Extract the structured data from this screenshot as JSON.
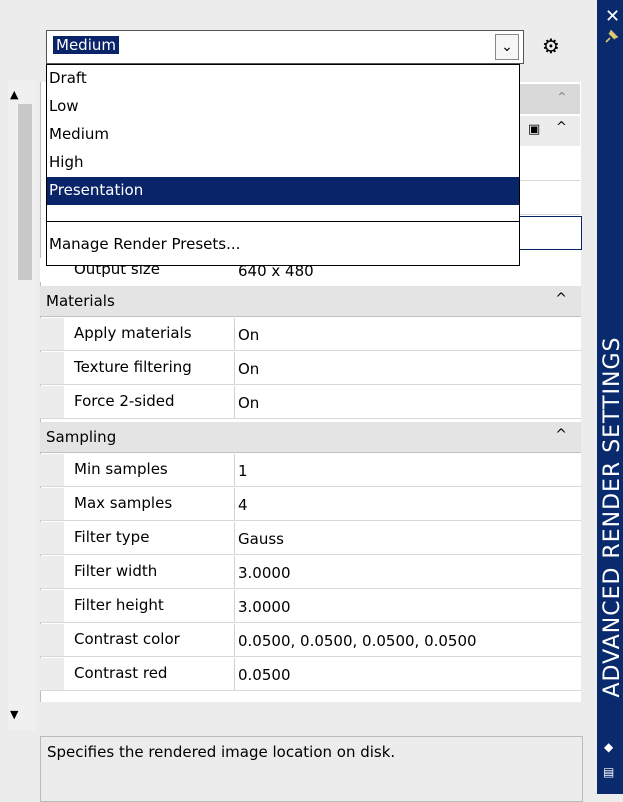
{
  "palette": {
    "title": "ADVANCED RENDER SETTINGS",
    "preset_combo": {
      "selected": "Medium",
      "options": [
        "Draft",
        "Low",
        "Medium",
        "High",
        "Presentation"
      ],
      "highlighted": "Presentation",
      "manage_label": "Manage Render Presets..."
    },
    "output_size": {
      "label": "Output size",
      "value": "640 x 480"
    },
    "sections": [
      {
        "name": "Materials",
        "rows": [
          {
            "label": "Apply materials",
            "value": "On"
          },
          {
            "label": "Texture filtering",
            "value": "On"
          },
          {
            "label": "Force 2-sided",
            "value": "On"
          }
        ]
      },
      {
        "name": "Sampling",
        "rows": [
          {
            "label": "Min samples",
            "value": "1"
          },
          {
            "label": "Max samples",
            "value": "4"
          },
          {
            "label": "Filter type",
            "value": "Gauss"
          },
          {
            "label": "Filter width",
            "value": "3.0000"
          },
          {
            "label": "Filter height",
            "value": "3.0000"
          },
          {
            "label": "Contrast color",
            "value": "0.0500, 0.0500, 0.0500, 0.0500"
          },
          {
            "label": "Contrast red",
            "value": "0.0500"
          }
        ]
      }
    ],
    "description": "Specifies the rendered image location on disk.",
    "icons": {
      "close": "close-icon",
      "pin": "pin-icon",
      "settings": "render-settings-icon"
    }
  }
}
